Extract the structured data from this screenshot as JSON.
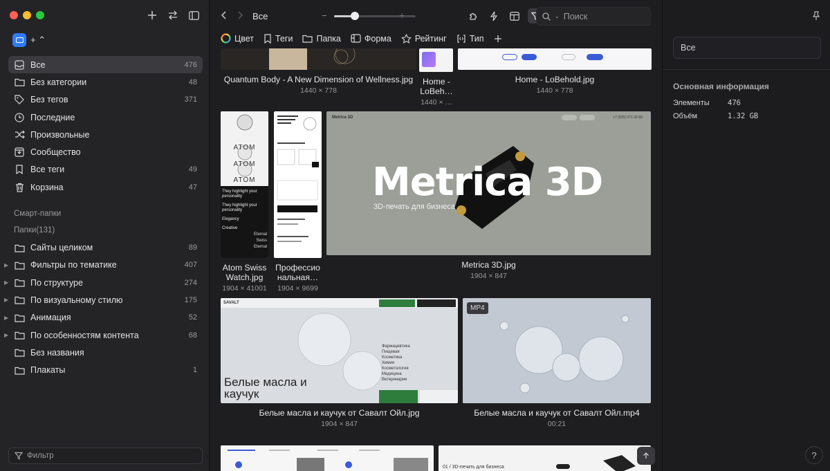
{
  "window": {
    "traffic_colors": [
      "#fe5f57",
      "#febc2e",
      "#28c840"
    ]
  },
  "sidebar": {
    "library_suffix": "+ ⌃",
    "items": [
      {
        "label": "Все",
        "count": "476",
        "icon": "inbox-icon",
        "active": true
      },
      {
        "label": "Без категории",
        "count": "48",
        "icon": "folder-outline-icon"
      },
      {
        "label": "Без тегов",
        "count": "371",
        "icon": "tag-outline-icon"
      },
      {
        "label": "Последние",
        "count": "",
        "icon": "clock-icon"
      },
      {
        "label": "Произвольные",
        "count": "",
        "icon": "shuffle-icon"
      },
      {
        "label": "Сообщество",
        "count": "",
        "icon": "download-box-icon"
      },
      {
        "label": "Все теги",
        "count": "49",
        "icon": "bookmark-icon"
      },
      {
        "label": "Корзина",
        "count": "47",
        "icon": "trash-icon"
      }
    ],
    "smart_folders_label": "Смарт-папки",
    "folders_label": "Папки(131)",
    "folders": [
      {
        "label": "Сайты целиком",
        "count": "89",
        "expandable": false
      },
      {
        "label": "Фильтры по тематике",
        "count": "407",
        "expandable": true
      },
      {
        "label": "По структуре",
        "count": "274",
        "expandable": true
      },
      {
        "label": "По визуальному стилю",
        "count": "175",
        "expandable": true
      },
      {
        "label": "Анимация",
        "count": "52",
        "expandable": true
      },
      {
        "label": "По особенностям контента",
        "count": "68",
        "expandable": true
      },
      {
        "label": "Без названия",
        "count": "",
        "expandable": false
      },
      {
        "label": "Плакаты",
        "count": "1",
        "expandable": false
      }
    ],
    "filter_placeholder": "Фильтр"
  },
  "toolbar": {
    "title": "Все",
    "search_placeholder": "Поиск",
    "zoom_fraction": 0.25
  },
  "filters": [
    {
      "label": "Цвет",
      "icon": "color-wheel-icon"
    },
    {
      "label": "Теги",
      "icon": "bookmark-icon"
    },
    {
      "label": "Папка",
      "icon": "folder-icon"
    },
    {
      "label": "Форма",
      "icon": "shape-icon"
    },
    {
      "label": "Рейтинг",
      "icon": "star-icon"
    },
    {
      "label": "Тип",
      "icon": "file-type-icon"
    }
  ],
  "items": [
    {
      "name": "Quantum Body - A New Dimension of Wellness.jpg",
      "meta": "1440 × 778"
    },
    {
      "name": "Home - LoBeh…",
      "meta": "1440 × …"
    },
    {
      "name": "Home - LoBehold.jpg",
      "meta": "1440 × 778"
    },
    {
      "name": "Atom Swiss Watch.jpg",
      "meta": "1904 × 41001"
    },
    {
      "name": "Профессио нальная…",
      "meta": "1904 × 9699"
    },
    {
      "name": "Metrica 3D.jpg",
      "meta": "1904 × 847"
    },
    {
      "name": "Белые масла и каучук от Савалт Ойл.jpg",
      "meta": "1904 × 847"
    },
    {
      "name": "Белые масла и каучук от Савалт Ойл.mp4",
      "meta": "00:21"
    }
  ],
  "thumbs": {
    "atom_words": [
      "ATOM",
      "ATOM",
      "ATOM"
    ],
    "atom_texts": [
      "They highlight your personality",
      "They highlight your personality",
      "Elegancy",
      "Creative"
    ],
    "atom_side": [
      "Eternal",
      "Swiss",
      "Eternal"
    ],
    "metrica_big": "Metrica 3D",
    "metrica_sub": "3D-печать для бизнеса",
    "metrica_nav_logo": "Metrica 3D",
    "metrica_phone": "+7 (925) 071-30-60",
    "oil_title": "Белые масла и каучук",
    "oil_list": [
      "Фармацевтика",
      "Пищевая",
      "Косметика",
      "Химия",
      "Косметология",
      "Медицина",
      "Ветеринария"
    ],
    "oil_logo": "SAVALT",
    "video_badge": "MP4",
    "bottom_right_text": "01 / 3D-печать для бизнеса"
  },
  "inspector": {
    "name_value": "Все",
    "section_title": "Основная информация",
    "rows": [
      {
        "label": "Элементы",
        "value": "476"
      },
      {
        "label": "Объём",
        "value": "1.32 GB"
      }
    ]
  }
}
